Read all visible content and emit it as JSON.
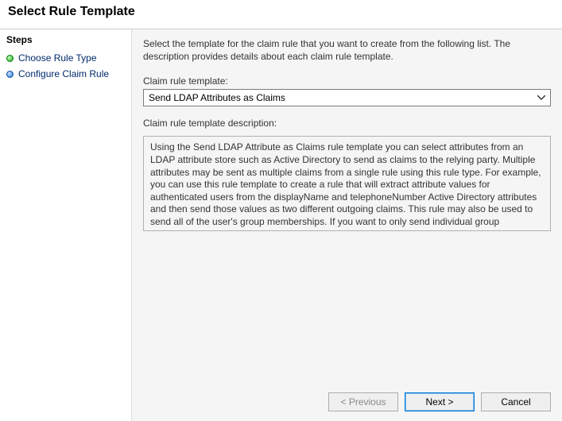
{
  "title": "Select Rule Template",
  "sidebar": {
    "heading": "Steps",
    "items": [
      {
        "label": "Choose Rule Type",
        "active": true
      },
      {
        "label": "Configure Claim Rule",
        "active": false
      }
    ]
  },
  "intro": "Select the template for the claim rule that you want to create from the following list. The description provides details about each claim rule template.",
  "template_label": "Claim rule template:",
  "template_selected": "Send LDAP Attributes as Claims",
  "description_label": "Claim rule template description:",
  "description_text": "Using the Send LDAP Attribute as Claims rule template you can select attributes from an LDAP attribute store such as Active Directory to send as claims to the relying party. Multiple attributes may be sent as multiple claims from a single rule using this rule type. For example, you can use this rule template to create a rule that will extract attribute values for authenticated users from the displayName and telephoneNumber Active Directory attributes and then send those values as two different outgoing claims. This rule may also be used to send all of the user's group memberships. If you want to only send individual group memberships, use the Send Group Membership as a Claim rule template.",
  "buttons": {
    "previous": "< Previous",
    "next": "Next >",
    "cancel": "Cancel"
  }
}
